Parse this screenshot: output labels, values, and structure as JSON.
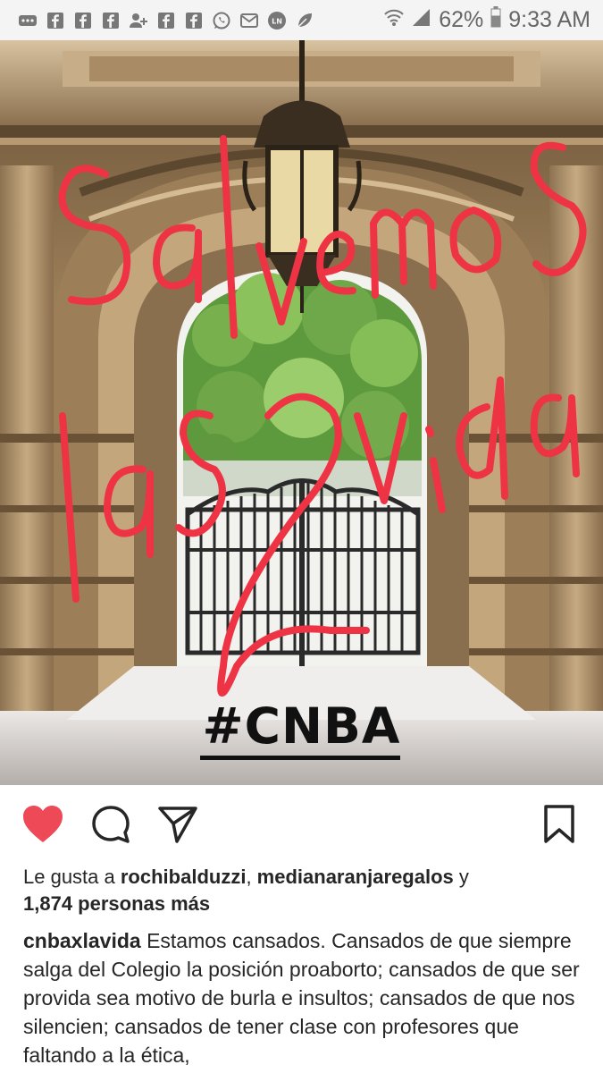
{
  "status_bar": {
    "battery": "62%",
    "time": "9:33 AM",
    "icons": [
      "more-icon",
      "facebook-icon",
      "facebook-icon",
      "facebook-icon",
      "add-user-icon",
      "facebook-icon",
      "facebook-icon",
      "whatsapp-icon",
      "mail-icon",
      "ln-news-icon",
      "leaf-icon",
      "wifi-icon",
      "signal-icon",
      "battery-icon"
    ]
  },
  "post": {
    "overlay_text": [
      "Salvemos",
      "las 2 vidas"
    ],
    "hashtag": "#CNBA",
    "colors": {
      "overlay": "#ee3344",
      "like": "#ed4956"
    }
  },
  "actions": {
    "like_icon": "heart-icon",
    "comment_icon": "comment-icon",
    "share_icon": "send-icon",
    "save_icon": "bookmark-icon"
  },
  "likes": {
    "prefix": "Le gusta a ",
    "user1": "rochibalduzzi",
    "sep": ", ",
    "user2": "medianaranjaregalos",
    "and": " y",
    "count": "1,874 personas más"
  },
  "caption": {
    "username": "cnbaxlavida",
    "text": " Estamos cansados. Cansados de que siempre salga del Colegio la posición proaborto; cansados de que ser provida sea motivo de burla e insultos; cansados de que nos silencien; cansados de tener clase con profesores que faltando a la ética,"
  }
}
